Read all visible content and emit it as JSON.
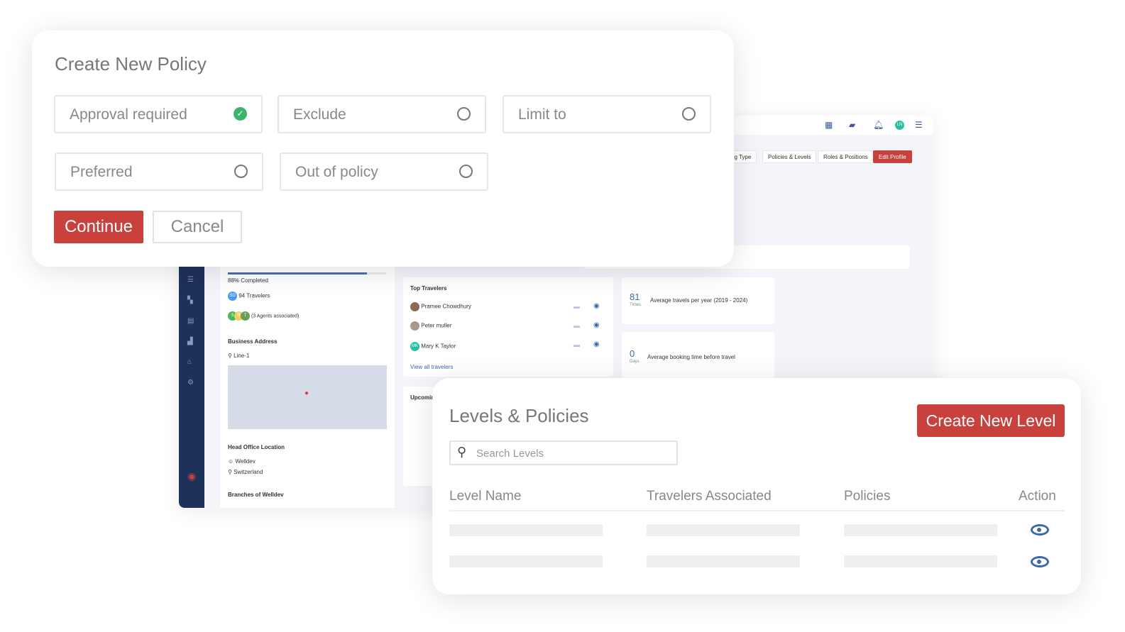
{
  "background_app": {
    "tabs": [
      "ng Type",
      "Policies & Levels",
      "Roles & Positions",
      "Edit Profile"
    ],
    "user_initials": "LN",
    "progress": {
      "label": "88% Completed",
      "value": 88
    },
    "travelers": {
      "initials": "SD",
      "label": "94 Travelers"
    },
    "agents": {
      "initials": [
        "S",
        "R",
        "T"
      ],
      "label": "(3 Agents associated)"
    },
    "business_address": {
      "title": "Business Address",
      "line": "Line-1"
    },
    "head_office": {
      "title": "Head Office Location",
      "name": "Welldev",
      "country": "Switzerland"
    },
    "branches_title": "Branches of Welldev",
    "top_travelers": {
      "title": "Top Travelers",
      "items": [
        {
          "name": "Pramee Chowdhury"
        },
        {
          "name": "Peter muller"
        },
        {
          "name": "Mary K Taylor",
          "initials": "MK"
        }
      ],
      "view_all": "View all travelers"
    },
    "stats": [
      {
        "value": "81",
        "unit": "Times",
        "label": "Average travels per year (2019 - 2024)"
      },
      {
        "value": "0",
        "unit": "Days",
        "label": "Average booking time before travel"
      }
    ],
    "upcoming_title": "Upcomin"
  },
  "policy_modal": {
    "title": "Create New Policy",
    "options": [
      {
        "label": "Approval required",
        "selected": true
      },
      {
        "label": "Exclude",
        "selected": false
      },
      {
        "label": "Limit to",
        "selected": false
      },
      {
        "label": "Preferred",
        "selected": false
      },
      {
        "label": "Out of policy",
        "selected": false
      }
    ],
    "continue": "Continue",
    "cancel": "Cancel"
  },
  "levels_panel": {
    "title": "Levels & Policies",
    "create_button": "Create New Level",
    "search_placeholder": "Search Levels",
    "columns": [
      "Level Name",
      "Travelers Associated",
      "Policies",
      "Action"
    ]
  },
  "colors": {
    "accent": "#c9413c",
    "navy": "#1e3159",
    "check": "#3bb36b",
    "eye": "#3c6aa8"
  }
}
